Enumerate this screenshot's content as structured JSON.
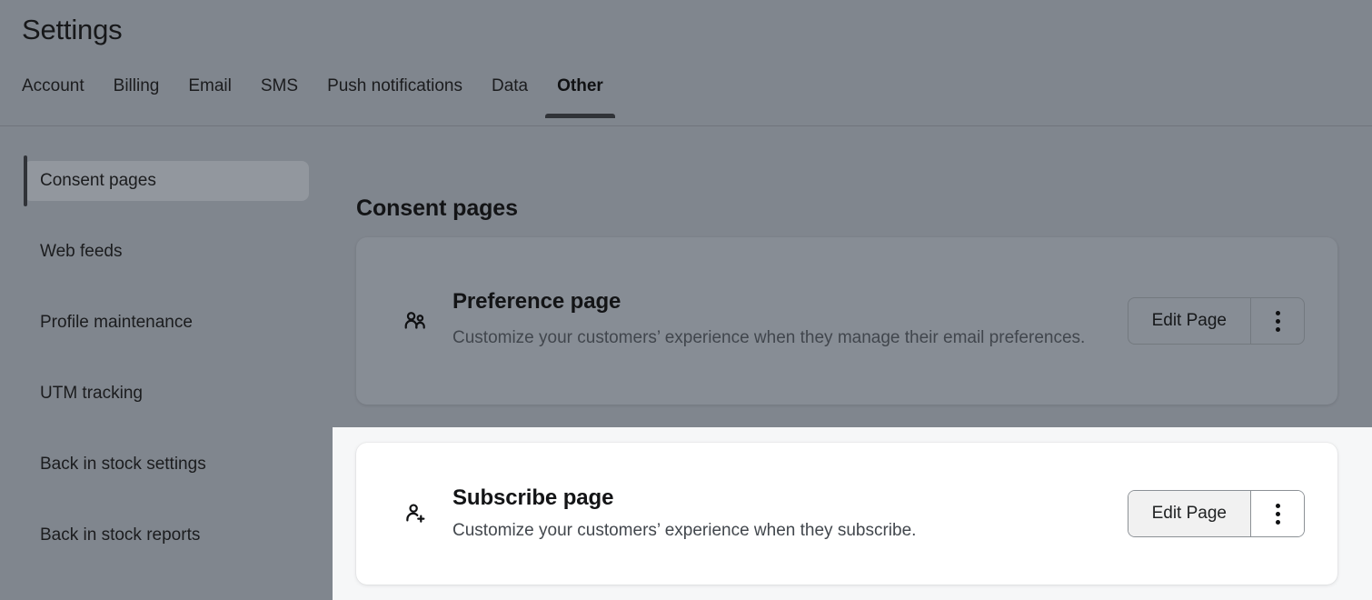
{
  "header": {
    "title": "Settings",
    "tabs": [
      {
        "label": "Account",
        "active": false
      },
      {
        "label": "Billing",
        "active": false
      },
      {
        "label": "Email",
        "active": false
      },
      {
        "label": "SMS",
        "active": false
      },
      {
        "label": "Push notifications",
        "active": false
      },
      {
        "label": "Data",
        "active": false
      },
      {
        "label": "Other",
        "active": true
      }
    ]
  },
  "sidebar": {
    "items": [
      {
        "label": "Consent pages",
        "active": true
      },
      {
        "label": "Web feeds",
        "active": false
      },
      {
        "label": "Profile maintenance",
        "active": false
      },
      {
        "label": "UTM tracking",
        "active": false
      },
      {
        "label": "Back in stock settings",
        "active": false
      },
      {
        "label": "Back in stock reports",
        "active": false
      }
    ]
  },
  "main": {
    "title": "Consent pages",
    "cards": [
      {
        "icon": "users-icon",
        "heading": "Preference page",
        "description": "Customize your customers’ experience when they manage their email preferences.",
        "primary_button": "Edit Page",
        "more_button": "more-actions"
      },
      {
        "icon": "person-add-icon",
        "heading": "Subscribe page",
        "description": "Customize your customers’ experience when they subscribe.",
        "primary_button": "Edit Page",
        "more_button": "more-actions"
      }
    ]
  },
  "colors": {
    "dim_overlay": "#80868e",
    "spotlight_background": "#f6f7f8",
    "card_background": "#ffffff",
    "active_tab_indicator": "#303338",
    "text_primary": "#131416",
    "text_secondary": "#41464d",
    "button_fill": "#f1f1f1"
  }
}
